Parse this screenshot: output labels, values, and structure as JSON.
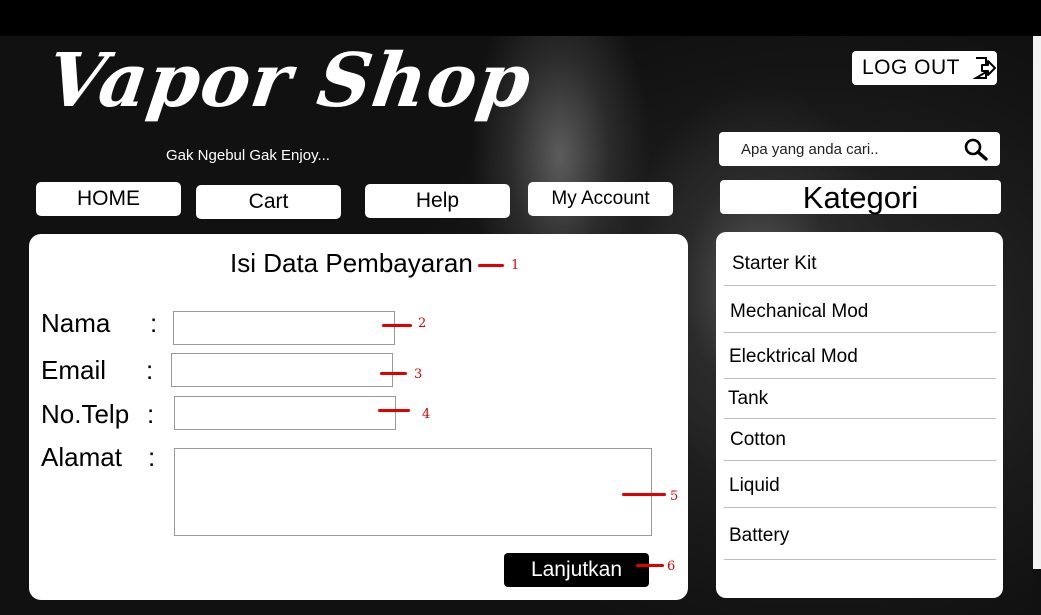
{
  "brand": {
    "name": "Vapor Shop",
    "tagline": "Gak Ngebul Gak Enjoy..."
  },
  "header": {
    "logout_label": "LOG OUT",
    "search_placeholder": "Apa yang anda cari.."
  },
  "nav": {
    "home": "HOME",
    "cart": "Cart",
    "help": "Help",
    "account": "My Account"
  },
  "form": {
    "title": "Isi Data Pembayaran",
    "name_label": "Nama",
    "email_label": "Email",
    "phone_label": "No.Telp",
    "address_label": "Alamat",
    "colon": ":",
    "submit_label": "Lanjutkan"
  },
  "annotations": [
    "1",
    "2",
    "3",
    "4",
    "5",
    "6"
  ],
  "categories": {
    "heading": "Kategori",
    "items": [
      "Starter Kit",
      "Mechanical Mod",
      "Elecktrical Mod",
      "Tank",
      "Cotton",
      "Liquid",
      "Battery"
    ]
  },
  "colors": {
    "annotation": "#e00000",
    "background": "#111111",
    "panel": "#ffffff",
    "submit": "#000000"
  }
}
